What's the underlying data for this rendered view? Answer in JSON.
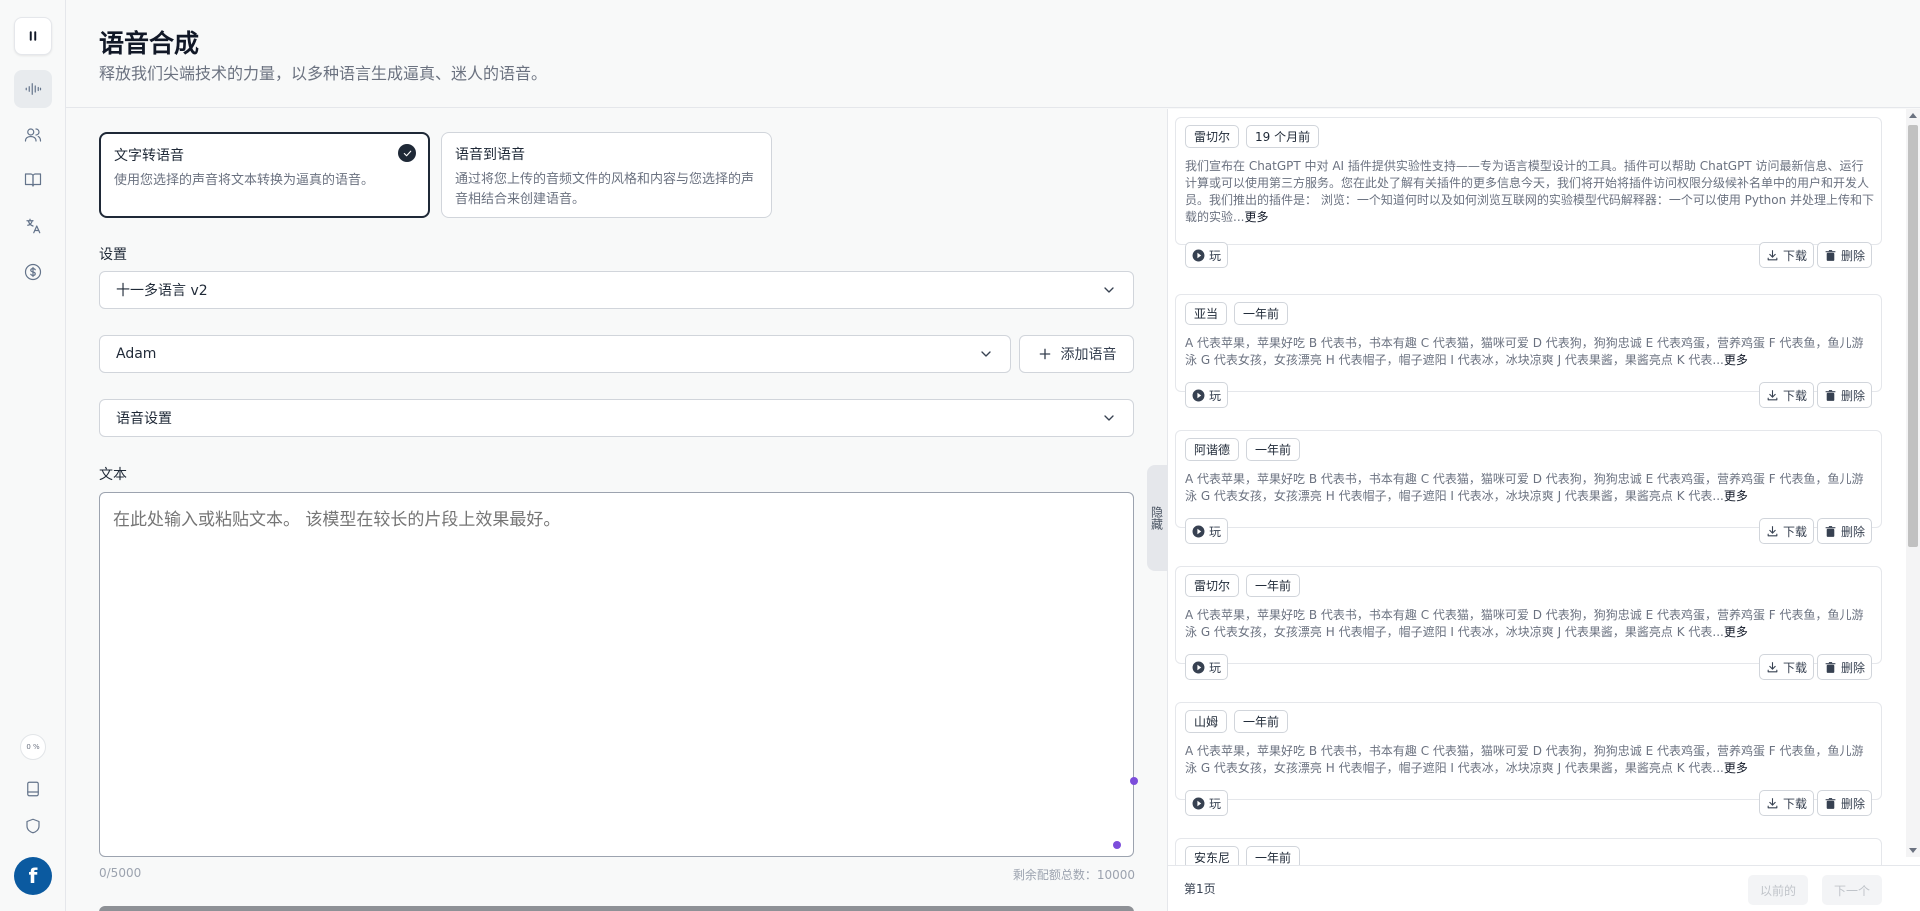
{
  "header": {
    "title": "语音合成",
    "subtitle": "释放我们尖端技术的力量，以多种语言生成逼真、迷人的语音。"
  },
  "rail": {
    "icons": [
      "pause-icon",
      "waveform-icon",
      "users-icon",
      "book-icon",
      "translate-icon",
      "dollar-icon",
      "library-icon",
      "shield-icon"
    ],
    "usage_percent": "0 %",
    "avatar_letter": "f"
  },
  "modes": [
    {
      "title": "文字转语音",
      "desc": "使用您选择的声音将文本转换为逼真的语音。",
      "selected": true
    },
    {
      "title": "语音到语音",
      "desc": "通过将您上传的音频文件的风格和内容与您选择的声音相结合来创建语音。",
      "selected": false
    }
  ],
  "settings": {
    "label": "设置",
    "model_value": "十一多语言 v2",
    "voice_value": "Adam",
    "add_voice_label": "添加语音",
    "voice_settings_label": "语音设置"
  },
  "text_input": {
    "label": "文本",
    "placeholder": "在此处输入或粘贴文本。 该模型在较长的片段上效果最好。",
    "char_count": "0/5000",
    "remaining": "剩余配额总数：10000"
  },
  "hide_tab_label": "隐藏",
  "history": {
    "items": [
      {
        "voice": "雷切尔",
        "time": "19 个月前",
        "text": "我们宣布在 ChatGPT 中对 AI 插件提供实验性支持——专为语言模型设计的工具。插件可以帮助 ChatGPT 访问最新信息、运行计算或可以使用第三方服务。您在此处了解有关插件的更多信息今天，我们将开始将插件访问权限分级候补名单中的用户和开发人员。我们推出的插件是： 浏览：一个知道何时以及如何浏览互联网的实验模型代码解释器：一个可以使用 Python 并处理上传和下载的实验...",
        "more": "更多"
      },
      {
        "voice": "亚当",
        "time": "一年前",
        "text": "A 代表苹果，苹果好吃 B 代表书，书本有趣 C 代表猫，猫咪可爱 D 代表狗，狗狗忠诚 E 代表鸡蛋，营养鸡蛋 F 代表鱼，鱼儿游泳 G 代表女孩，女孩漂亮 H 代表帽子，帽子遮阳 I 代表冰，冰块凉爽 J 代表果酱，果酱亮点 K 代表...",
        "more": "更多"
      },
      {
        "voice": "阿谐德",
        "time": "一年前",
        "text": "A 代表苹果，苹果好吃 B 代表书，书本有趣 C 代表猫，猫咪可爱 D 代表狗，狗狗忠诚 E 代表鸡蛋，营养鸡蛋 F 代表鱼，鱼儿游泳 G 代表女孩，女孩漂亮 H 代表帽子，帽子遮阳 I 代表冰，冰块凉爽 J 代表果酱，果酱亮点 K 代表...",
        "more": "更多"
      },
      {
        "voice": "雷切尔",
        "time": "一年前",
        "text": "A 代表苹果，苹果好吃 B 代表书，书本有趣 C 代表猫，猫咪可爱 D 代表狗，狗狗忠诚 E 代表鸡蛋，营养鸡蛋 F 代表鱼，鱼儿游泳 G 代表女孩，女孩漂亮 H 代表帽子，帽子遮阳 I 代表冰，冰块凉爽 J 代表果酱，果酱亮点 K 代表...",
        "more": "更多"
      },
      {
        "voice": "山姆",
        "time": "一年前",
        "text": "A 代表苹果，苹果好吃 B 代表书，书本有趣 C 代表猫，猫咪可爱 D 代表狗，狗狗忠诚 E 代表鸡蛋，营养鸡蛋 F 代表鱼，鱼儿游泳 G 代表女孩，女孩漂亮 H 代表帽子，帽子遮阳 I 代表冰，冰块凉爽 J 代表果酱，果酱亮点 K 代表...",
        "more": "更多"
      },
      {
        "voice": "安东尼",
        "time": "一年前",
        "text": "",
        "more": ""
      }
    ],
    "play_label": "玩",
    "download_label": "下载",
    "delete_label": "删除",
    "page_label": "第1页",
    "prev_label": "以前的",
    "next_label": "下一个"
  },
  "colors": {
    "accent": "#1f2937",
    "dot": "#7c4ddb",
    "avatar": "#0b5aa0"
  }
}
